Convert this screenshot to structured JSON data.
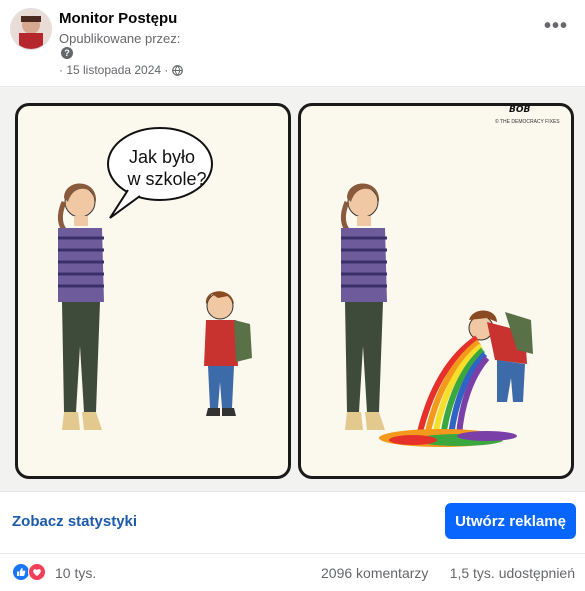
{
  "post": {
    "page_name": "Monitor Postępu",
    "published_by": "Opublikowane przez:",
    "help_glyph": "?",
    "date": "· 15 listopada 2024 ·",
    "privacy_icon": "globe-icon",
    "more_icon": "more-options-icon",
    "more_glyph": "•••"
  },
  "comic": {
    "speech_line_1": "Jak było",
    "speech_line_2": "w szkole?",
    "signature": "BOB",
    "copyright": "© THE DEMOCRACY FIXES"
  },
  "actions": {
    "stats_label": "Zobacz statystyki",
    "create_ad_label": "Utwórz reklamę",
    "button_color": "#0866ff"
  },
  "footer": {
    "reaction_types": [
      "like",
      "love"
    ],
    "reaction_count": "10 tys.",
    "comments": "2096 komentarzy",
    "shares": "1,5 tys. udostępnień"
  }
}
